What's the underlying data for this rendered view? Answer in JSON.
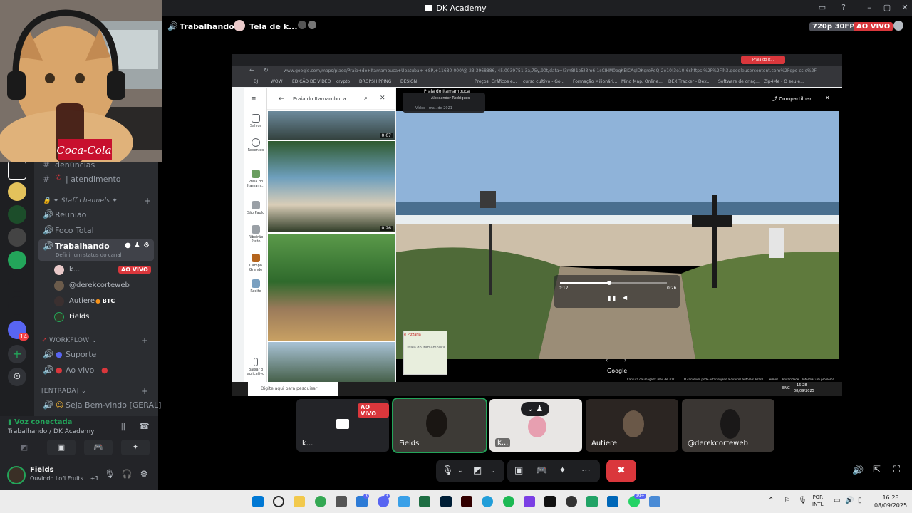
{
  "window": {
    "title": "DK Academy"
  },
  "stage": {
    "channel_name": "Trabalhando",
    "stream_title": "Tela de k...",
    "quality": "720p 30FPS",
    "live_label": "AO VIVO"
  },
  "sidebar": {
    "channels": [
      {
        "name": "denúncias"
      },
      {
        "name": "| atendimento"
      }
    ],
    "staff_category": "✦ Staff channels ✦",
    "voice_channels": [
      {
        "name": "Reunião"
      },
      {
        "name": "Foco Total"
      },
      {
        "name": "Trabalhando",
        "status": "Definir um status do canal"
      }
    ],
    "members": [
      {
        "name": "k...",
        "badge": "AO VIVO"
      },
      {
        "name": "@derekcorteweb"
      },
      {
        "name": "Autiere",
        "tag": "BTC"
      },
      {
        "name": "Fields"
      }
    ],
    "workflow_category": "WORKFLOW",
    "workflow_channels": [
      {
        "name": "Suporte"
      },
      {
        "name": "Ao vivo"
      }
    ],
    "entrada_category": "[ENTRADA]",
    "entrada_channels": [
      {
        "name": "Seja Bem-vindo [GERAL]"
      }
    ]
  },
  "server_rail": {
    "badge_count": "14"
  },
  "voice_panel": {
    "status": "Voz conectada",
    "location": "Trabalhando / DK Academy"
  },
  "user_panel": {
    "username": "Fields",
    "activity": "Ouvindo Lofi Fruits...",
    "extra": "+1"
  },
  "webcam": {
    "mug_text": "Coca-Cola"
  },
  "shared_screen": {
    "url": "www.google.com/maps/place/Praia+do+Itamambuca+Ubatuba+-+SP,+11680-000/@-23.3968886,-45.0039751,3a,75y,90t/data=!3m8!1e5!3m6!1sCIHM0ogKEICAgIDKgrePdQ!2e10!3e10!6shttps:%2F%2Flh3.googleusercontent.com%2Fgps-cs-s%2F",
    "bookmarks": [
      "DJ",
      "WOW",
      "EDIÇÃO DE VÍDEO",
      "crypto",
      "DROPSHIPPING",
      "DESIGN",
      "Preços, Gráficos e...",
      "curso cultivo - Go...",
      "Formação Milionári...",
      "Mind Map, Online...",
      "DEX Tracker - Dex...",
      "Software de criaç...",
      "Zip4Me - O seu e..."
    ],
    "maps_search": "Praia do Itamambuca",
    "nav": [
      {
        "label": "Salvos"
      },
      {
        "label": "Recentes"
      },
      {
        "label": "Praia do Itamam..."
      },
      {
        "label": "São Paulo"
      },
      {
        "label": "Ribeirão Preto"
      },
      {
        "label": "Campo Grande"
      },
      {
        "label": "Recife"
      },
      {
        "label": "Baixar o aplicativo"
      }
    ],
    "thumb_times": [
      "0:07",
      "0:26"
    ],
    "viewer_title": "Praia do Itamambuca",
    "viewer_author": "Alexsander Rodrigues",
    "viewer_date": "Vídeo · mai. de 2021",
    "share_label": "Compartilhar",
    "video_current": "0:12",
    "video_total": "0:26",
    "video_progress": 0.46,
    "google_label": "Google",
    "minimap_label": "Praia do Itamambuca",
    "minimap_pizzaria": "e Pizzaria",
    "footer_capture": "Captura da imagem: mai. de 2021",
    "footer_links": [
      "O conteúdo pode estar sujeito a direitos autorais",
      "Brasil",
      "Termos",
      "Privacidade",
      "Informar um problema"
    ],
    "taskbar_search": "Digite aqui para pesquisar",
    "clock_time": "16:28",
    "clock_date": "08/09/2025",
    "lang": "ENG",
    "tab_active": "Praia do It..."
  },
  "participants": [
    {
      "name": "k...",
      "badge": "AO VIVO"
    },
    {
      "name": "Fields"
    },
    {
      "name": "k..."
    },
    {
      "name": "Autiere"
    },
    {
      "name": "@derekcorteweb"
    }
  ],
  "taskbar": {
    "time": "16:28",
    "date": "08/09/2025",
    "lang_line1": "POR",
    "lang_line2": "INTL",
    "badge_counts": [
      "3",
      "99+",
      "3"
    ]
  },
  "colors": {
    "live": "#da373c",
    "voice_connected": "#23a55a",
    "discord_bg": "#2b2d31",
    "end_call": "#f23f43"
  }
}
